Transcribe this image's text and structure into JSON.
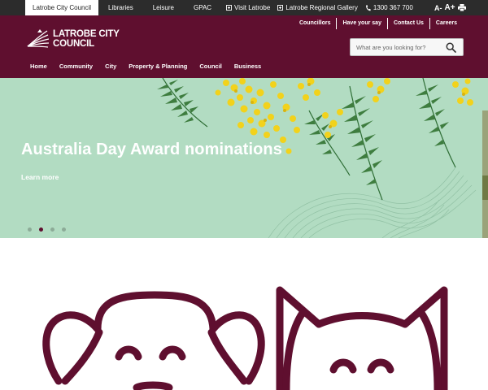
{
  "topbar": {
    "tabs": [
      {
        "label": "Latrobe City Council",
        "active": true
      },
      {
        "label": "Libraries",
        "active": false
      },
      {
        "label": "Leisure",
        "active": false
      },
      {
        "label": "GPAC",
        "active": false
      }
    ],
    "utility_links": [
      {
        "label": "Visit Latrobe",
        "icon": "external-box-icon"
      },
      {
        "label": "Latrobe Regional Gallery",
        "icon": "external-box-icon"
      },
      {
        "label": "1300 367 700",
        "icon": "phone-icon"
      }
    ],
    "font_decrease": "A-",
    "font_increase": "A+",
    "print_icon": "print-icon"
  },
  "header": {
    "logo": {
      "line1": "LATROBE CITY",
      "line2": "COUNCIL"
    },
    "quick_links": [
      "Councillors",
      "Have your say",
      "Contact Us",
      "Careers"
    ],
    "search": {
      "placeholder": "What are you looking for?",
      "icon": "search-icon"
    },
    "nav": [
      "Home",
      "Community",
      "City",
      "Property & Planning",
      "Council",
      "Business"
    ],
    "brand_color": "#5f0f2f"
  },
  "hero": {
    "title": "Australia Day Award nominations",
    "link": "Learn more",
    "slides_total": 4,
    "active_slide": 2,
    "background_color": "#b2dcc2"
  },
  "illustration": {
    "icons": [
      "dog-icon",
      "cat-icon"
    ],
    "color": "#5f0f2f"
  }
}
